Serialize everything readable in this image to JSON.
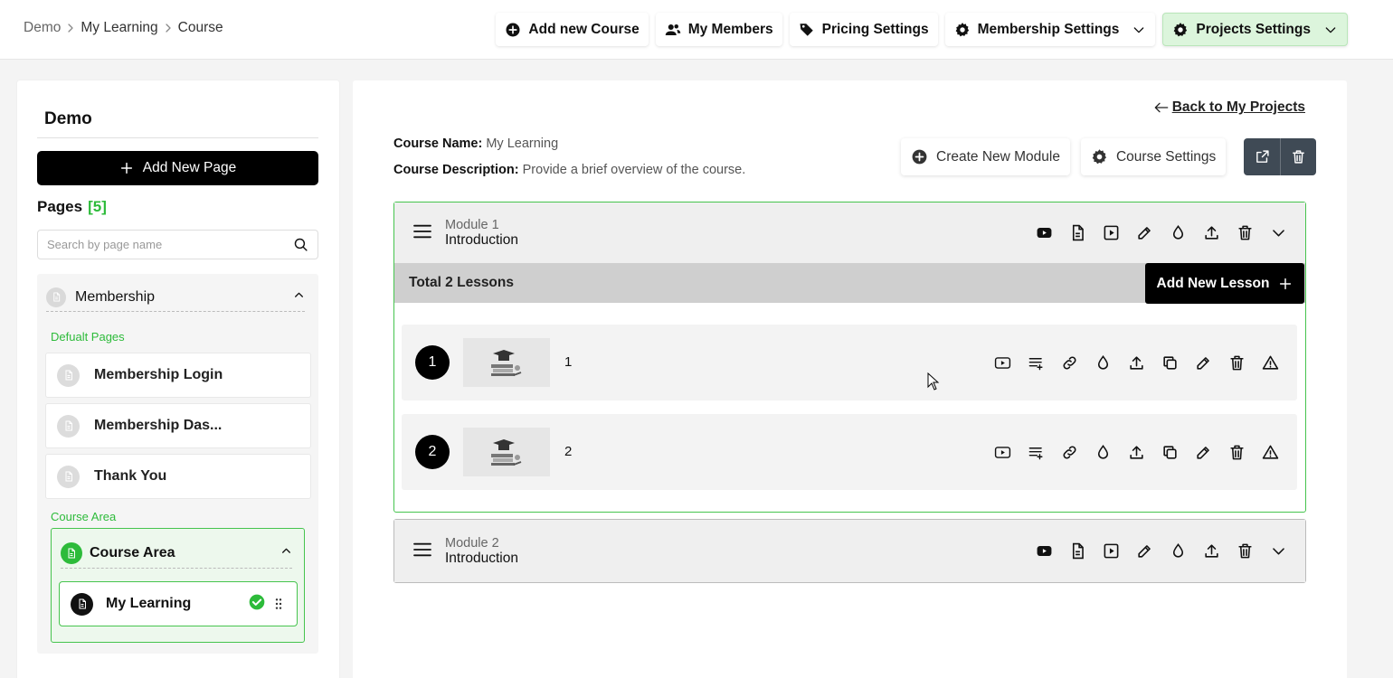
{
  "breadcrumb": {
    "items": [
      "Demo",
      "My Learning",
      "Course"
    ]
  },
  "topbar": {
    "add_course": "Add new Course",
    "members": "My Members",
    "pricing": "Pricing Settings",
    "membership": "Membership Settings",
    "projects": "Projects Settings"
  },
  "sidebar": {
    "title": "Demo",
    "add_page": "Add New Page",
    "pages_label": "Pages",
    "pages_count": "[5]",
    "search_placeholder": "Search by page name",
    "group_label": "Membership",
    "default_label": "Defualt Pages",
    "default_pages": [
      "Membership Login",
      "Membership Das...",
      "Thank You"
    ],
    "course_area_label": "Course Area",
    "course_area_title": "Course Area",
    "course_page": "My Learning"
  },
  "main": {
    "back": "Back to My Projects",
    "course_name_label": "Course Name:",
    "course_name": "My Learning",
    "course_desc_label": "Course Description:",
    "course_desc": "Provide a brief overview of the course.",
    "create_module": "Create New Module",
    "course_settings": "Course Settings",
    "modules": [
      {
        "label": "Module 1",
        "title": "Introduction"
      },
      {
        "label": "Module 2",
        "title": "Introduction"
      }
    ],
    "total_lessons": "Total 2 Lessons",
    "add_lesson": "Add New Lesson",
    "lessons": [
      {
        "num": "1",
        "name": "1"
      },
      {
        "num": "2",
        "name": "2"
      }
    ]
  },
  "colors": {
    "accent_green": "#2dbb3a",
    "module_border": "#46c44e",
    "dark_button": "#3f4a55"
  }
}
